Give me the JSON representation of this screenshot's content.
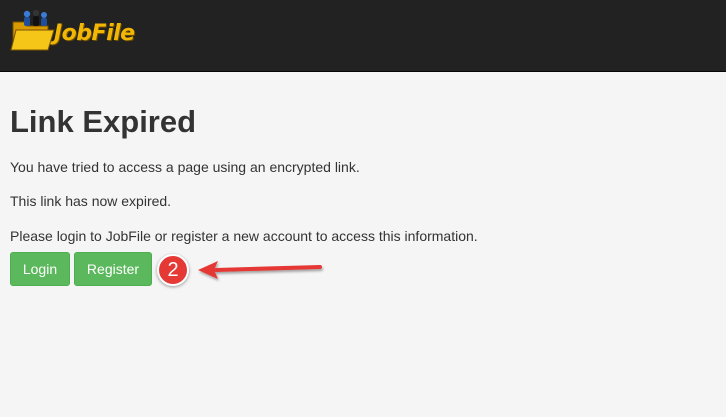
{
  "header": {
    "logo_text": "JobFile"
  },
  "main": {
    "title": "Link Expired",
    "paragraphs": [
      "You have tried to access a page using an encrypted link.",
      "This link has now expired.",
      "Please login to JobFile or register a new account to access this information."
    ],
    "login_label": "Login",
    "register_label": "Register"
  },
  "annotation": {
    "step_number": "2",
    "arrow_icon": "left-arrow-icon"
  },
  "colors": {
    "navbar": "#222222",
    "background": "#f5f5f5",
    "button_success": "#5cb85c",
    "logo_text": "#f2b705",
    "annotation_red": "#e53935"
  }
}
